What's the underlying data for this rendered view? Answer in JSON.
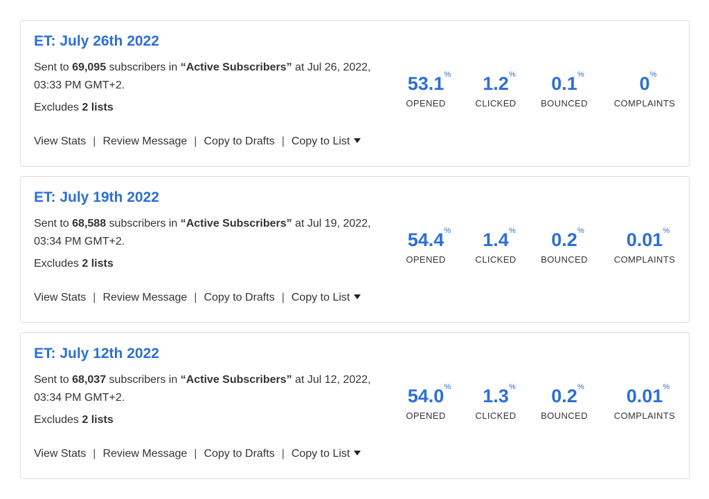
{
  "campaigns": [
    {
      "title": "ET: July 26th 2022",
      "sent_prefix": "Sent to ",
      "subscriber_count": "69,095",
      "sent_middle": " subscribers in ",
      "list_name": "“Active Subscribers”",
      "sent_suffix": " at Jul 26, 2022, 03:33 PM GMT+2.",
      "excludes_prefix": "Excludes ",
      "excludes_count": "2 lists",
      "stats": {
        "opened": {
          "value": "53.1",
          "unit": "%",
          "label": "OPENED"
        },
        "clicked": {
          "value": "1.2",
          "unit": "%",
          "label": "CLICKED"
        },
        "bounced": {
          "value": "0.1",
          "unit": "%",
          "label": "BOUNCED"
        },
        "complaints": {
          "value": "0",
          "unit": "%",
          "label": "COMPLAINTS"
        }
      }
    },
    {
      "title": "ET: July 19th 2022",
      "sent_prefix": "Sent to ",
      "subscriber_count": "68,588",
      "sent_middle": " subscribers in ",
      "list_name": "“Active Subscribers”",
      "sent_suffix": " at Jul 19, 2022, 03:34 PM GMT+2.",
      "excludes_prefix": "Excludes ",
      "excludes_count": "2 lists",
      "stats": {
        "opened": {
          "value": "54.4",
          "unit": "%",
          "label": "OPENED"
        },
        "clicked": {
          "value": "1.4",
          "unit": "%",
          "label": "CLICKED"
        },
        "bounced": {
          "value": "0.2",
          "unit": "%",
          "label": "BOUNCED"
        },
        "complaints": {
          "value": "0.01",
          "unit": "%",
          "label": "COMPLAINTS"
        }
      }
    },
    {
      "title": "ET: July 12th 2022",
      "sent_prefix": "Sent to ",
      "subscriber_count": "68,037",
      "sent_middle": " subscribers in ",
      "list_name": "“Active Subscribers”",
      "sent_suffix": " at Jul 12, 2022, 03:34 PM GMT+2.",
      "excludes_prefix": "Excludes ",
      "excludes_count": "2 lists",
      "stats": {
        "opened": {
          "value": "54.0",
          "unit": "%",
          "label": "OPENED"
        },
        "clicked": {
          "value": "1.3",
          "unit": "%",
          "label": "CLICKED"
        },
        "bounced": {
          "value": "0.2",
          "unit": "%",
          "label": "BOUNCED"
        },
        "complaints": {
          "value": "0.01",
          "unit": "%",
          "label": "COMPLAINTS"
        }
      }
    }
  ],
  "actions": {
    "view_stats": "View Stats",
    "review_message": "Review Message",
    "copy_to_drafts": "Copy to Drafts",
    "copy_to_list": "Copy to List",
    "separator": "|"
  },
  "icons": {
    "dropdown": "caret-down-icon"
  },
  "colors": {
    "accent": "#2b6fd6",
    "text": "#333333",
    "border": "#d9dcde"
  }
}
